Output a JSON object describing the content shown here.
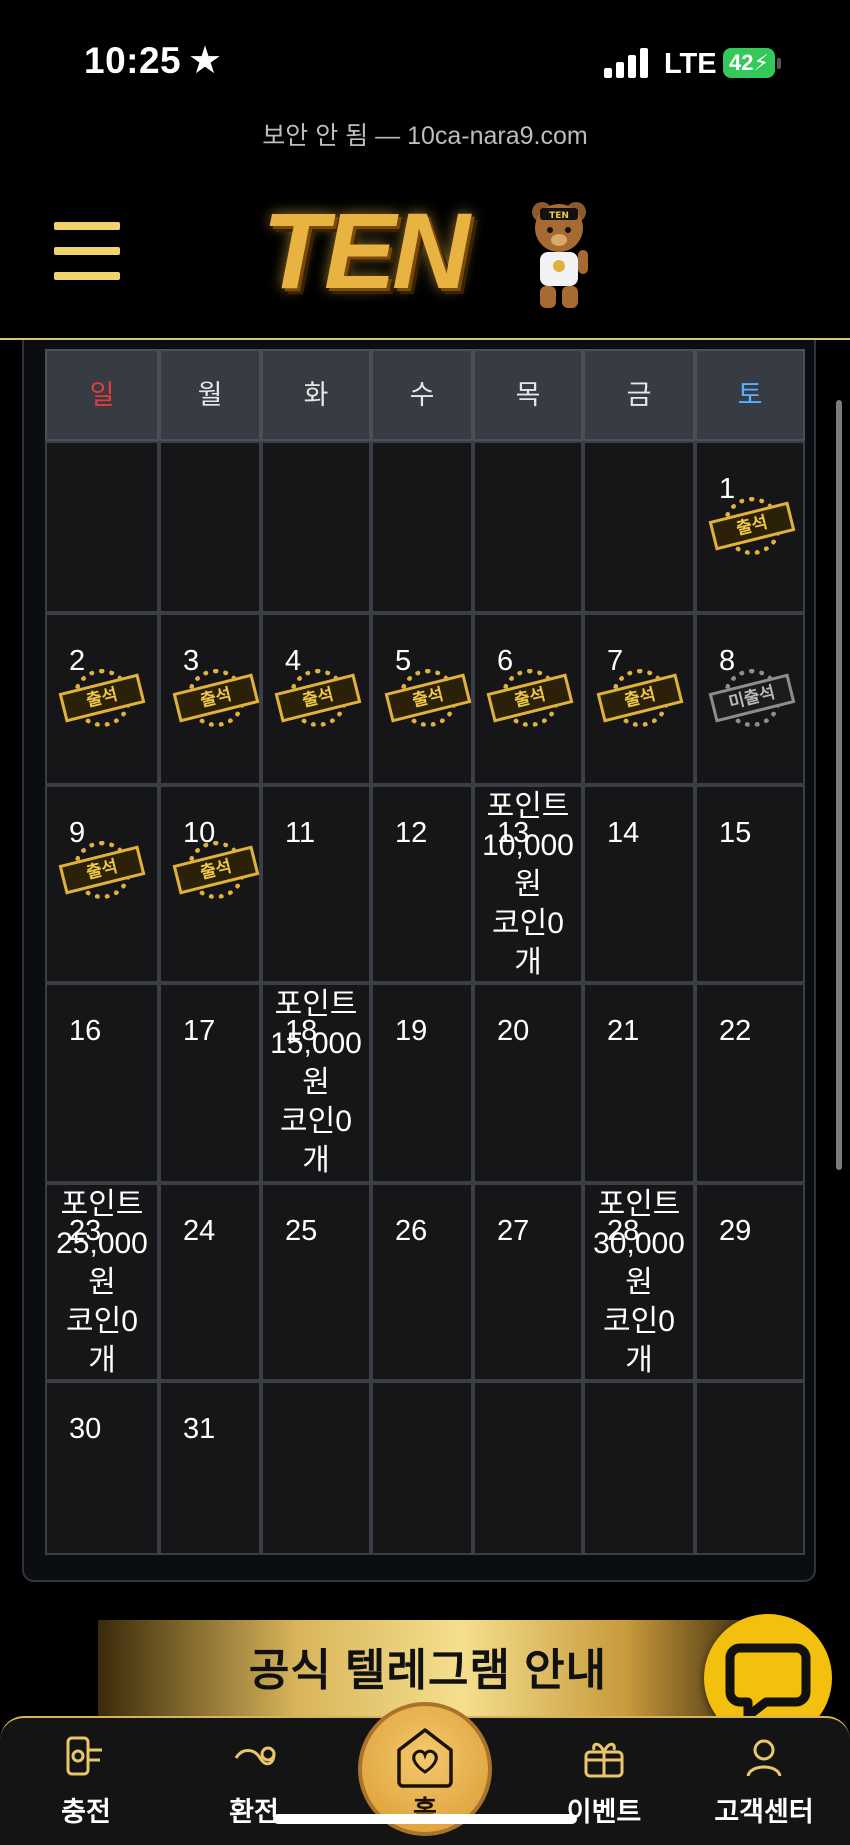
{
  "status_bar": {
    "time": "10:25",
    "network": "LTE",
    "battery": "42"
  },
  "browser": {
    "url": "보안 안 됨 — 10ca-nara9.com"
  },
  "header": {
    "logo_text": "TEN",
    "bear_badge": "TEN"
  },
  "calendar": {
    "weekdays": [
      "일",
      "월",
      "화",
      "수",
      "목",
      "금",
      "토"
    ],
    "stamp_present": "출석",
    "stamp_absent": "미출석",
    "weeks": [
      [
        {
          "day": "",
          "stamp": null,
          "reward": null
        },
        {
          "day": "",
          "stamp": null,
          "reward": null
        },
        {
          "day": "",
          "stamp": null,
          "reward": null
        },
        {
          "day": "",
          "stamp": null,
          "reward": null
        },
        {
          "day": "",
          "stamp": null,
          "reward": null
        },
        {
          "day": "",
          "stamp": null,
          "reward": null
        },
        {
          "day": "1",
          "stamp": "present",
          "reward": null
        }
      ],
      [
        {
          "day": "2",
          "stamp": "present",
          "reward": null
        },
        {
          "day": "3",
          "stamp": "present",
          "reward": null
        },
        {
          "day": "4",
          "stamp": "present",
          "reward": null
        },
        {
          "day": "5",
          "stamp": "present",
          "reward": null
        },
        {
          "day": "6",
          "stamp": "present",
          "reward": null
        },
        {
          "day": "7",
          "stamp": "present",
          "reward": null
        },
        {
          "day": "8",
          "stamp": "absent",
          "reward": null
        }
      ],
      [
        {
          "day": "9",
          "stamp": "present",
          "reward": null
        },
        {
          "day": "10",
          "stamp": "present",
          "reward": null
        },
        {
          "day": "11",
          "stamp": null,
          "reward": null
        },
        {
          "day": "12",
          "stamp": null,
          "reward": null
        },
        {
          "day": "13",
          "stamp": null,
          "reward": [
            "포인트",
            "10,000",
            "원",
            "코인0",
            "개"
          ]
        },
        {
          "day": "14",
          "stamp": null,
          "reward": null
        },
        {
          "day": "15",
          "stamp": null,
          "reward": null
        }
      ],
      [
        {
          "day": "16",
          "stamp": null,
          "reward": null
        },
        {
          "day": "17",
          "stamp": null,
          "reward": null
        },
        {
          "day": "18",
          "stamp": null,
          "reward": [
            "포인트",
            "15,000",
            "원",
            "코인0",
            "개"
          ]
        },
        {
          "day": "19",
          "stamp": null,
          "reward": null
        },
        {
          "day": "20",
          "stamp": null,
          "reward": null
        },
        {
          "day": "21",
          "stamp": null,
          "reward": null
        },
        {
          "day": "22",
          "stamp": null,
          "reward": null
        }
      ],
      [
        {
          "day": "23",
          "stamp": null,
          "reward": [
            "포인트",
            "25,000",
            "원",
            "코인0",
            "개"
          ]
        },
        {
          "day": "24",
          "stamp": null,
          "reward": null
        },
        {
          "day": "25",
          "stamp": null,
          "reward": null
        },
        {
          "day": "26",
          "stamp": null,
          "reward": null
        },
        {
          "day": "27",
          "stamp": null,
          "reward": null
        },
        {
          "day": "28",
          "stamp": null,
          "reward": [
            "포인트",
            "30,000",
            "원",
            "코인0",
            "개"
          ]
        },
        {
          "day": "29",
          "stamp": null,
          "reward": null
        }
      ],
      [
        {
          "day": "30",
          "stamp": null,
          "reward": null
        },
        {
          "day": "31",
          "stamp": null,
          "reward": null
        },
        {
          "day": "",
          "stamp": null,
          "reward": null
        },
        {
          "day": "",
          "stamp": null,
          "reward": null
        },
        {
          "day": "",
          "stamp": null,
          "reward": null
        },
        {
          "day": "",
          "stamp": null,
          "reward": null
        },
        {
          "day": "",
          "stamp": null,
          "reward": null
        }
      ]
    ]
  },
  "banner": {
    "text": "공식 텔레그램 안내"
  },
  "bottom_nav": {
    "items": [
      {
        "label": "충전",
        "icon": "deposit-icon"
      },
      {
        "label": "환전",
        "icon": "exchange-icon"
      },
      {
        "label": "홈",
        "icon": "home-heart-icon"
      },
      {
        "label": "이벤트",
        "icon": "gift-icon"
      },
      {
        "label": "고객센터",
        "icon": "support-icon"
      }
    ]
  },
  "colors": {
    "gold": "#e0b23c",
    "sunday": "#e23c3c",
    "saturday": "#5ab0ff",
    "chat_fab": "#f3c00e"
  }
}
